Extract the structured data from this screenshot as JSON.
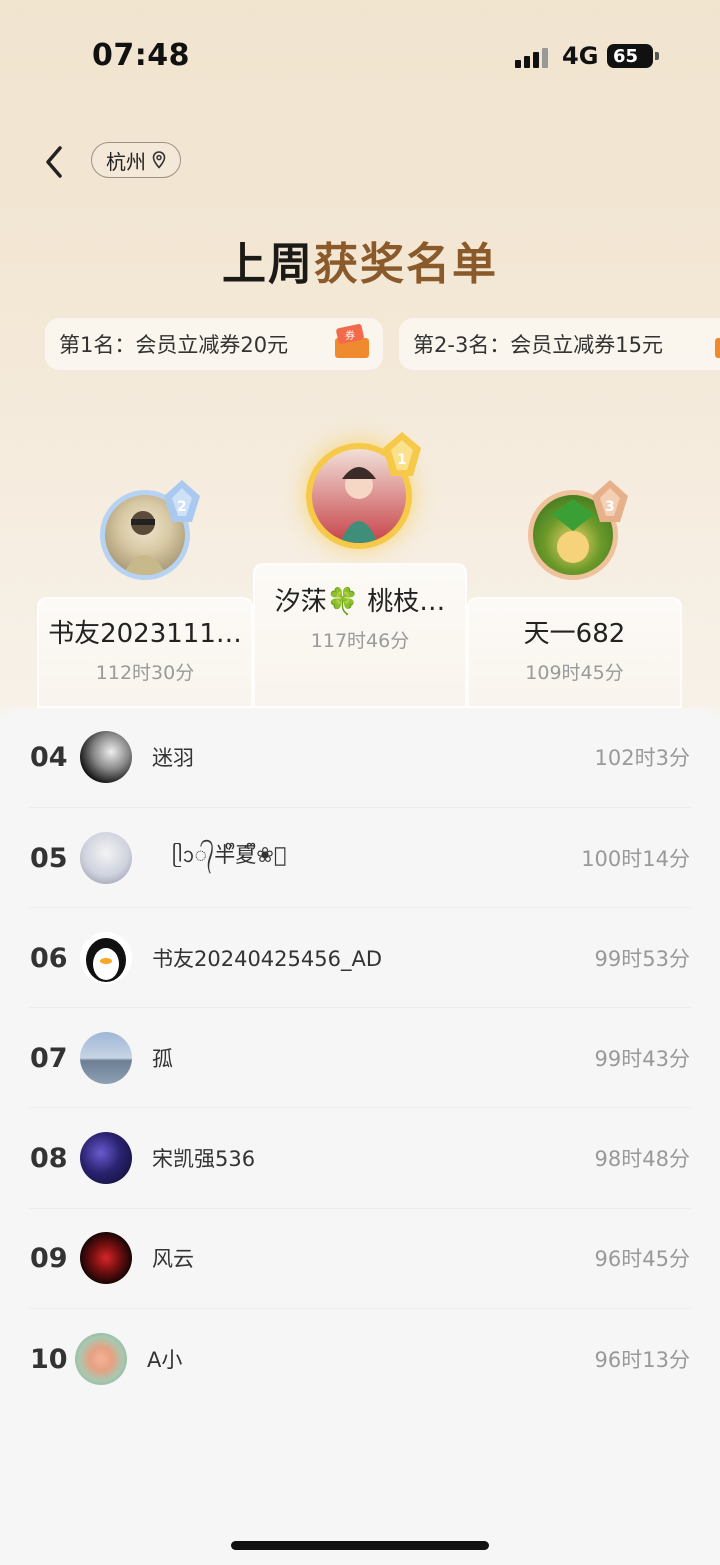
{
  "status": {
    "time": "07:48",
    "network": "4G",
    "battery": "65"
  },
  "header": {
    "city": "杭州",
    "title_part1": "上周",
    "title_part2": "获奖名单"
  },
  "prizes": [
    {
      "text": "第1名：会员立减券20元",
      "gift_label": "券"
    },
    {
      "text": "第2-3名：会员立减券15元"
    }
  ],
  "podium": [
    {
      "rank": "1",
      "name": "汐莯🍀 桃枝…",
      "time": "117时46分"
    },
    {
      "rank": "2",
      "name": "书友2023111…",
      "time": "112时30分"
    },
    {
      "rank": "3",
      "name": "天一682",
      "time": "109时45分"
    }
  ],
  "list": [
    {
      "rank": "04",
      "name": "迷羽",
      "time": "102时3分"
    },
    {
      "rank": "05",
      "name": "ᥫᩣ᭄半ᩚ夏ᩚ❀ᩚ",
      "time": "100时14分"
    },
    {
      "rank": "06",
      "name": "书友20240425456_AD",
      "time": "99时53分"
    },
    {
      "rank": "07",
      "name": "孤",
      "time": "99时43分"
    },
    {
      "rank": "08",
      "name": "宋凯强536",
      "time": "98时48分"
    },
    {
      "rank": "09",
      "name": "风云",
      "time": "96时45分"
    },
    {
      "rank": "10",
      "name": "A小",
      "time": "96时13分"
    }
  ],
  "colors": {
    "gold": "#f7c948",
    "silver": "#a9c9ef",
    "bronze": "#e6b08a",
    "title_brown": "#8b5a2b"
  }
}
